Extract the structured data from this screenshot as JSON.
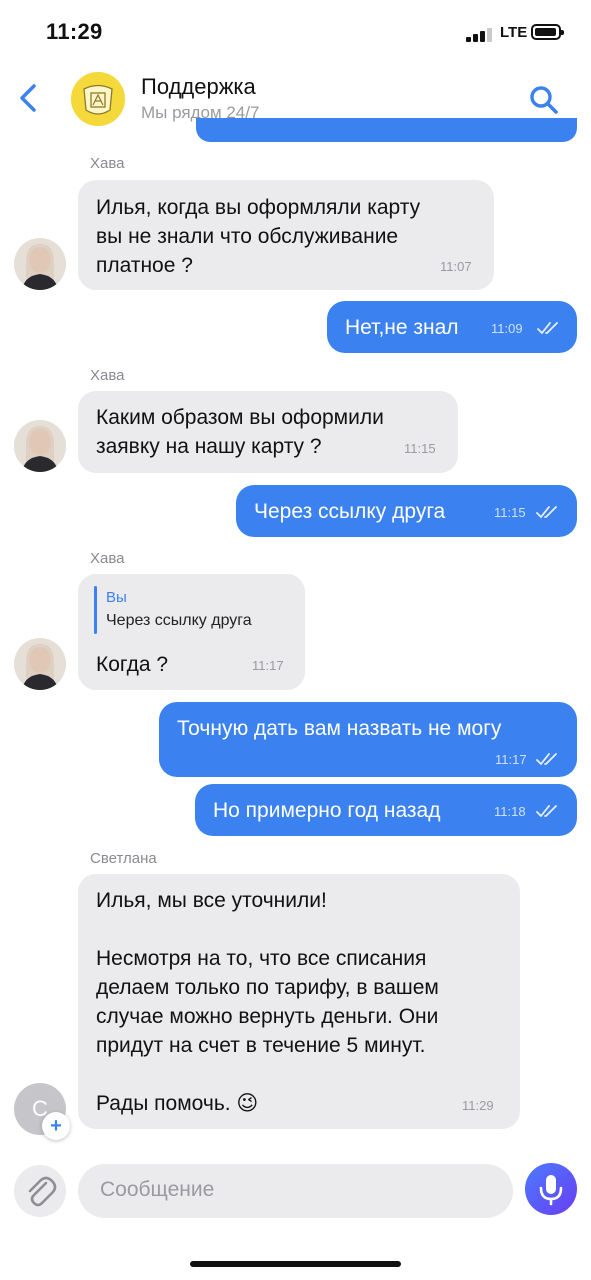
{
  "status_bar": {
    "time": "11:29",
    "network": "LTE"
  },
  "header": {
    "title": "Поддержка",
    "subtitle": "Мы рядом 24/7"
  },
  "messages": [
    {
      "sender": "Хава",
      "text": "Илья, когда вы оформляли карту\nвы не знали что обслуживание\nплатное ?",
      "time": "11:07"
    },
    {
      "text": "Нет,не знал",
      "time": "11:09"
    },
    {
      "sender": "Хава",
      "text": "Каким образом вы оформили\nзаявку на нашу карту ?",
      "time": "11:15"
    },
    {
      "text": "Через ссылку друга",
      "time": "11:15"
    },
    {
      "sender": "Хава",
      "reply_to": {
        "author": "Вы",
        "text": "Через ссылку друга"
      },
      "text": "Когда ?",
      "time": "11:17"
    },
    {
      "text": "Точную дать вам назвать не могу",
      "time": "11:17"
    },
    {
      "text": "Но примерно год назад",
      "time": "11:18"
    },
    {
      "sender": "Светлана",
      "avatar_letter": "С",
      "text": "Илья, мы все уточнили!\n\nНесмотря на то, что все списания\nделаем только по тарифу, в вашем\nслучае можно вернуть деньги. Они\nпридут на счет в течение 5 минут.\n\nРады помочь. 😉",
      "time": "11:29"
    }
  ],
  "composer": {
    "placeholder": "Сообщение"
  },
  "colors": {
    "accent": "#3b82f0",
    "incoming_bubble": "#ebebed",
    "mic_gradient_start": "#4a7cff",
    "mic_gradient_end": "#6a3cf2"
  },
  "icons": [
    "back-chevron-icon",
    "bank-logo-icon",
    "search-icon",
    "double-check-icon",
    "paperclip-icon",
    "microphone-icon",
    "plus-icon"
  ]
}
